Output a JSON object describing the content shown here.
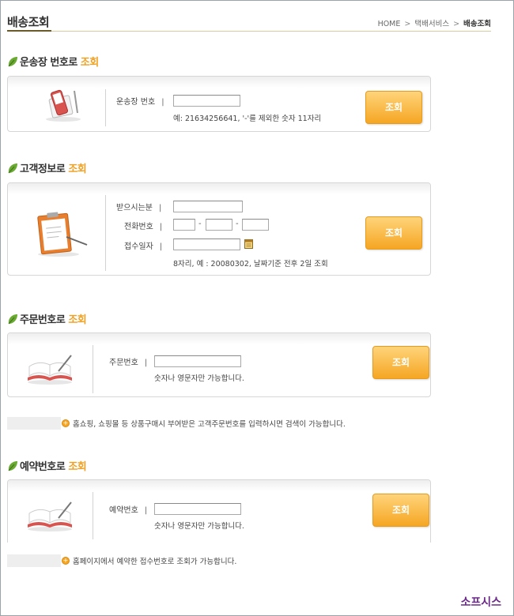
{
  "header": {
    "title": "배송조회",
    "breadcrumb": [
      "HOME",
      "택배서비스",
      "배송조회"
    ],
    "separator": ">"
  },
  "sections": {
    "waybill": {
      "title": "운송장 번호로",
      "title_highlight": "조회",
      "field_label": "운송장 번호",
      "hint": "예: 21634256641, '-'를 제외한 숫자 11자리",
      "button": "조회",
      "icon": "mobile-phone-icon"
    },
    "customer": {
      "title": "고객정보로",
      "title_highlight": "조회",
      "fields": [
        "받으시는분",
        "전화번호",
        "접수일자"
      ],
      "phone_separator": "-",
      "hint": "8자리, 예 : 20080302, 날짜기준 전후 2일 조회",
      "button": "조회",
      "icon": "clipboard-icon"
    },
    "order": {
      "title": "주문번호로",
      "title_highlight": "조회",
      "field_label": "주문번호",
      "hint": "숫자나 영문자만 가능합니다.",
      "button": "조회",
      "note": "홈쇼핑, 쇼핑몰 등 상품구매시 부여받은 고객주문번호를 입력하시면 검색이 가능합니다.",
      "icon": "open-book-icon"
    },
    "reservation": {
      "title": "예약번호로",
      "title_highlight": "조회",
      "field_label": "예약번호",
      "hint": "숫자나 영문자만 가능합니다.",
      "button": "조회",
      "note": "홈페이지에서 예약한 접수번호로 조회가 가능합니다.",
      "icon": "open-book-icon"
    }
  },
  "footer": {
    "brand": "소프시스"
  },
  "colors": {
    "accent": "#f5a623",
    "highlight": "#f0a020",
    "brand": "#6b2a8a",
    "leaf": "#5a9a2a"
  }
}
